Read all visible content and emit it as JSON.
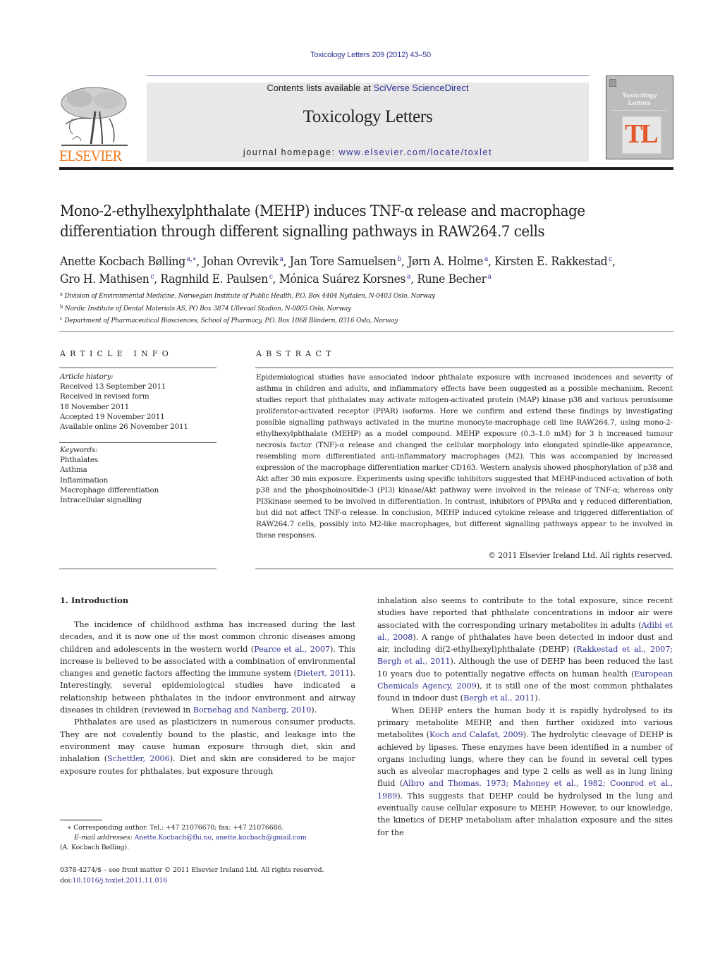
{
  "header": {
    "journal_ref": "Toxicology Letters 209 (2012) 43–50",
    "contents_prefix": "Contents lists available at ",
    "contents_link": "SciVerse ScienceDirect",
    "journal_title": "Toxicology Letters",
    "homepage_prefix": "journal homepage: ",
    "homepage_link": "www.elsevier.com/locate/toxlet",
    "publisher_logo_text": "ELSEVIER",
    "cover": {
      "title_line1": "Toxicology",
      "title_line2": "Letters",
      "monogram": "TL"
    },
    "colors": {
      "link": "#2e3192",
      "publisher": "#f47920",
      "cover_accent": "#e4592a",
      "banner_bg": "#e8e8e8"
    }
  },
  "article": {
    "title": "Mono-2-ethylhexylphthalate (MEHP) induces TNF-α release and macrophage differentiation through different signalling pathways in RAW264.7 cells",
    "authors": [
      {
        "name": "Anette Kocbach Bølling",
        "sup": "a,∗",
        "sep": ", "
      },
      {
        "name": "Johan Ovrevik",
        "sup": "a",
        "sep": ", "
      },
      {
        "name": "Jan Tore Samuelsen",
        "sup": "b",
        "sep": ", "
      },
      {
        "name": "Jørn A. Holme",
        "sup": "a",
        "sep": ", "
      },
      {
        "name": "Kirsten E. Rakkestad",
        "sup": "c",
        "sep": ","
      },
      {
        "name": "Gro H. Mathisen",
        "sup": "c",
        "sep": ", "
      },
      {
        "name": "Ragnhild E. Paulsen",
        "sup": "c",
        "sep": ", "
      },
      {
        "name": "Mónica Suárez Korsnes",
        "sup": "a",
        "sep": ", "
      },
      {
        "name": "Rune Becher",
        "sup": "a",
        "sep": ""
      }
    ],
    "affiliations": [
      {
        "key": "a",
        "text": "Division of Environmental Medicine, Norwegian Institute of Public Health, P.O. Box 4404 Nydalen, N-0403 Oslo, Norway"
      },
      {
        "key": "b",
        "text": "Nordic Institute of Dental Materials AS, PO Box 3874 Ullevaal Stadion, N-0805 Oslo, Norway"
      },
      {
        "key": "c",
        "text": "Department of Pharmaceutical Biosciences, School of Pharmacy, P.O. Box 1068 Blindern, 0316 Oslo, Norway"
      }
    ]
  },
  "article_info": {
    "heading": "ARTICLE INFO",
    "history_label": "Article history:",
    "history": [
      "Received 13 September 2011",
      "Received in revised form",
      "18 November 2011",
      "Accepted 19 November 2011",
      "Available online 26 November 2011"
    ],
    "keywords_label": "Keywords:",
    "keywords": [
      "Phthalates",
      "Asthma",
      "Inflammation",
      "Macrophage differentiation",
      "Intracellular signalling"
    ]
  },
  "abstract": {
    "heading": "ABSTRACT",
    "text": "Epidemiological studies have associated indoor phthalate exposure with increased incidences and severity of asthma in children and adults, and inflammatory effects have been suggested as a possible mechanism. Recent studies report that phthalates may activate mitogen-activated protein (MAP) kinase p38 and various peroxisome proliferator-activated receptor (PPAR) isoforms. Here we confirm and extend these findings by investigating possible signalling pathways activated in the murine monocyte-macrophage cell line RAW264.7, using mono-2-ethylhexylphthalate (MEHP) as a model compound. MEHP exposure (0.3–1.0 mM) for 3 h increased tumour necrosis factor (TNF)-α release and changed the cellular morphology into elongated spindle-like appearance, resembling more differentiated anti-inflammatory macrophages (M2). This was accompanied by increased expression of the macrophage differentiation marker CD163. Western analysis showed phosphorylation of p38 and Akt after 30 min exposure. Experiments using specific inhibitors suggested that MEHP-induced activation of both p38 and the phosphoinositide-3 (PI3) kinase/Akt pathway were involved in the release of TNF-α; whereas only PI3kinase seemed to be involved in differentiation. In contrast, inhibitors of PPARα and γ reduced differentiation, but did not affect TNF-α release. In conclusion, MEHP induced cytokine release and triggered differentiation of RAW264.7 cells, possibly into M2-like macrophages, but different signalling pathways appear to be involved in these responses.",
    "copyright": "© 2011 Elsevier Ireland Ltd. All rights reserved."
  },
  "body": {
    "section_heading": "1.  Introduction",
    "left_paragraphs": [
      [
        {
          "t": "The incidence of childhood asthma has increased during the last decades, and it is now one of the most common chronic diseases among children and adolescents in the western world ("
        },
        {
          "t": "Pearce et al., 2007",
          "link": true
        },
        {
          "t": "). This increase is believed to be associated with a combination of environmental changes and genetic factors affecting the immune system ("
        },
        {
          "t": "Dietert, 2011",
          "link": true
        },
        {
          "t": "). Interestingly, several epidemiological studies have indicated a relationship between phthalates in the indoor environment and airway diseases in children (reviewed in "
        },
        {
          "t": "Bornehag and Nanberg, 2010",
          "link": true
        },
        {
          "t": ")."
        }
      ],
      [
        {
          "t": "Phthalates are used as plasticizers in numerous consumer products. They are not covalently bound to the plastic, and leakage into the environment may cause human exposure through diet, skin and inhalation ("
        },
        {
          "t": "Schettler, 2006",
          "link": true
        },
        {
          "t": "). Diet and skin are considered to be major exposure routes for phthalates, but exposure through"
        }
      ]
    ],
    "right_paragraphs": [
      [
        {
          "t": "inhalation also seems to contribute to the total exposure, since recent studies have reported that phthalate concentrations in indoor air were associated with the corresponding urinary metabolites in adults ("
        },
        {
          "t": "Adibi et al., 2008",
          "link": true
        },
        {
          "t": "). A range of phthalates have been detected in indoor dust and air, including di(2-ethylhexyl)phthalate (DEHP) ("
        },
        {
          "t": "Rakkestad et al., 2007; Bergh et al., 2011",
          "link": true
        },
        {
          "t": "). Although the use of DEHP has been reduced the last 10 years due to potentially negative effects on human health ("
        },
        {
          "t": "European Chemicals Agency, 2009",
          "link": true
        },
        {
          "t": "), it is still one of the most common phthalates found in indoor dust ("
        },
        {
          "t": "Bergh et al., 2011",
          "link": true
        },
        {
          "t": ")."
        }
      ],
      [
        {
          "t": "When DEHP enters the human body it is rapidly hydrolysed to its primary metabolite MEHP, and then further oxidized into various metabolites ("
        },
        {
          "t": "Koch and Calafat, 2009",
          "link": true
        },
        {
          "t": "). The hydrolytic cleavage of DEHP is achieved by lipases. These enzymes have been identified in a number of organs including lungs, where they can be found in several cell types such as alveolar macrophages and type 2 cells as well as in lung lining fluid ("
        },
        {
          "t": "Albro and Thomas, 1973; Mahoney et al., 1982; Coonrod et al., 1989",
          "link": true
        },
        {
          "t": "). This suggests that DEHP could be hydrolysed in the lung and eventually cause cellular exposure to MEHP. However, to our knowledge, the kinetics of DEHP metabolism after inhalation exposure and the sites for the"
        }
      ]
    ]
  },
  "footnote": {
    "marker": "∗",
    "corresponding": "Corresponding author. Tel.: +47 21076670; fax: +47 21076686.",
    "email_label": "E-mail addresses:",
    "email1": "Anette.Kocbach@fhi.no",
    "email2": "anette.kocbach@gmail.com",
    "email_owner": "(A. Kocbach Bølling).",
    "front_matter": "0378-4274/$ – see front matter © 2011 Elsevier Ireland Ltd. All rights reserved.",
    "doi_prefix": "doi:",
    "doi": "10.1016/j.toxlet.2011.11.016"
  }
}
